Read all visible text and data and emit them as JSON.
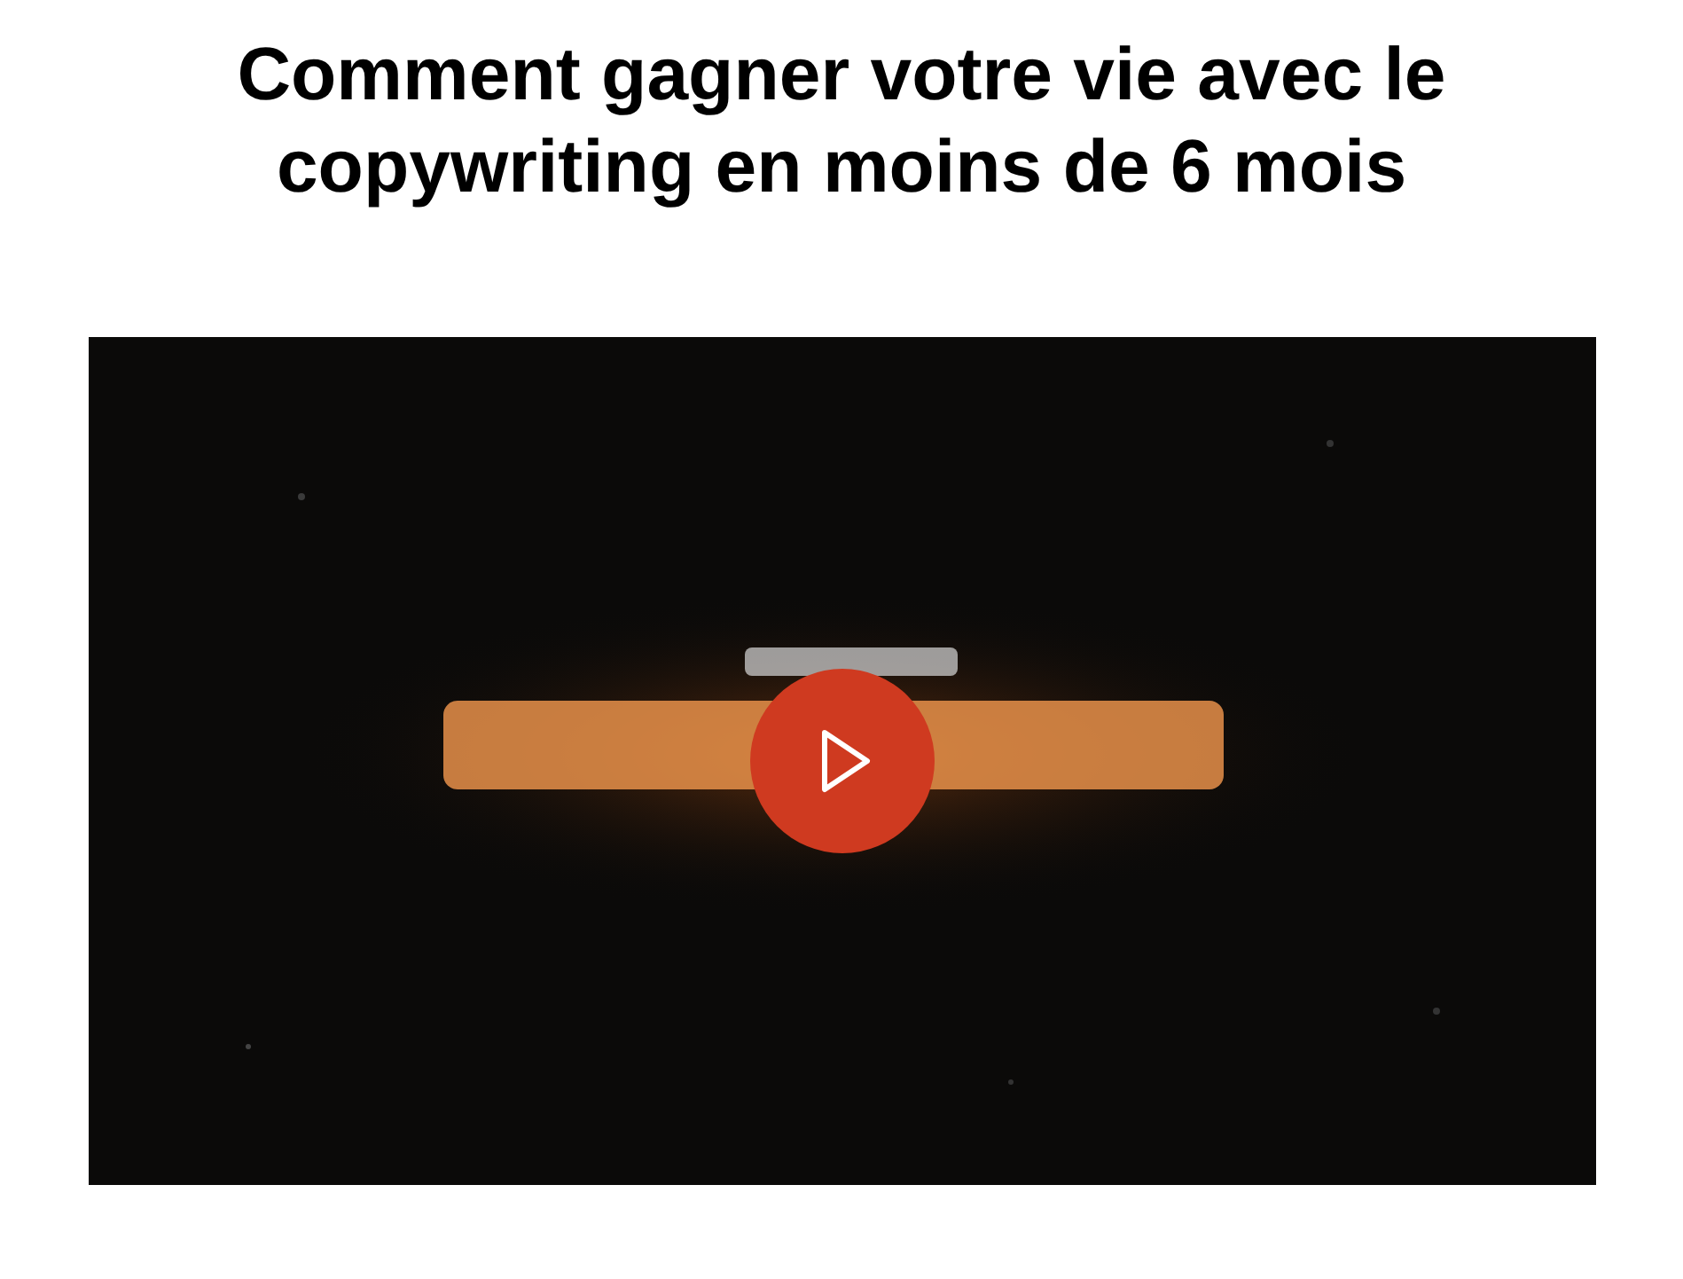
{
  "heading": "Comment gagner votre vie avec le copywriting en moins de 6 mois"
}
